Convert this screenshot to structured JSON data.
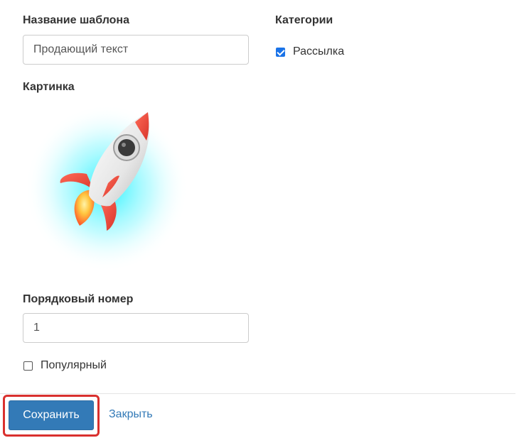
{
  "form": {
    "template_name_label": "Название шаблона",
    "template_name_value": "Продающий текст",
    "categories_label": "Категории",
    "categories": [
      {
        "label": "Рассылка",
        "checked": true
      }
    ],
    "picture_label": "Картинка",
    "picture_icon": "rocket-icon",
    "order_label": "Порядковый номер",
    "order_value": "1",
    "popular_label": "Популярный",
    "popular_checked": false
  },
  "footer": {
    "save_label": "Сохранить",
    "close_label": "Закрыть"
  },
  "colors": {
    "primary": "#337ab7",
    "highlight": "#d9302e",
    "checkbox": "#1a73e8"
  }
}
